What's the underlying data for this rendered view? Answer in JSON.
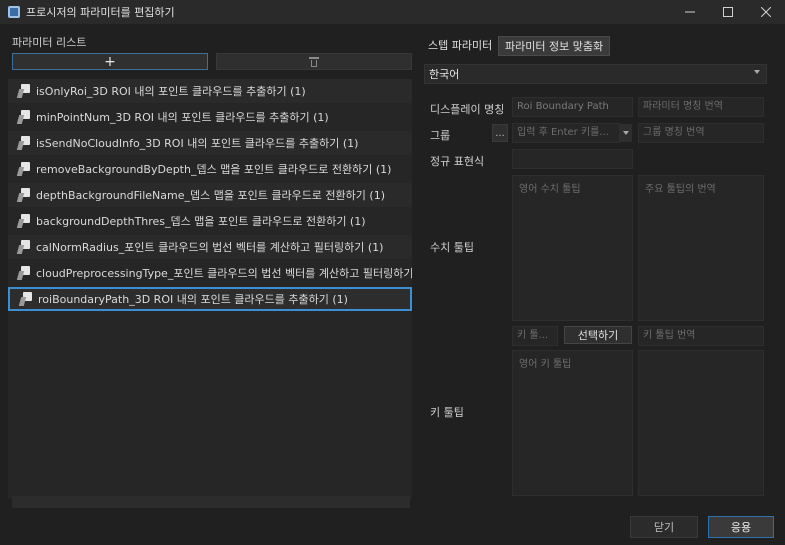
{
  "window": {
    "title": "프로시저의 파라미터를 편집하기"
  },
  "left_panel": {
    "label": "파라미터 리스트",
    "add_symbol": "+",
    "items": [
      "isOnlyRoi_3D ROI 내의 포인트 클라우드를 추출하기 (1)",
      "minPointNum_3D ROI 내의 포인트 클라우드를 추출하기 (1)",
      "isSendNoCloudInfo_3D ROI 내의 포인트 클라우드를 추출하기 (1)",
      "removeBackgroundByDepth_뎁스 맵을 포인트 클라우드로 전환하기 (1)",
      "depthBackgroundFileName_뎁스 맵을 포인트 클라우드로 전환하기 (1)",
      "backgroundDepthThres_뎁스 맵을 포인트 클라우드로 전환하기 (1)",
      "calNormRadius_포인트 클라우드의 법선 벡터를 계산하고 필터링하기 (1)",
      "cloudPreprocessingType_포인트 클라우드의 법선 벡터를 계산하고 필터링하기 (",
      "roiBoundaryPath_3D ROI 내의 포인트 클라우드를 추출하기 (1)"
    ],
    "selected_index": 8
  },
  "right_panel": {
    "tabs": [
      "스텝 파라미터",
      "파라미터 정보 맞춤화"
    ],
    "language": "한국어",
    "display_name_label": "디스플레이 명칭",
    "display_name_value": "Roi Boundary Path",
    "display_name_translation_placeholder": "파라미터 명칭 번역",
    "group_label": "그룹",
    "group_small_button": "...",
    "group_input_placeholder": "입력 후 Enter 키를...",
    "group_translation_placeholder": "그룹 명칭 번역",
    "regex_label": "정규 표현식",
    "tooltip_label": "수치 툴팁",
    "tooltip_english_placeholder": "영어 수치 툴팁",
    "tooltip_translation_placeholder": "주요 툴팁의 번역",
    "key_tooltip_label": "키 툴팁",
    "key_small_placeholder": "키 툴...",
    "select_button": "선택하기",
    "key_translation_placeholder": "키 툴팁 번역",
    "key_english_placeholder": "영어 키 툴팁"
  },
  "footer": {
    "close_label": "닫기",
    "apply_label": "응용"
  }
}
